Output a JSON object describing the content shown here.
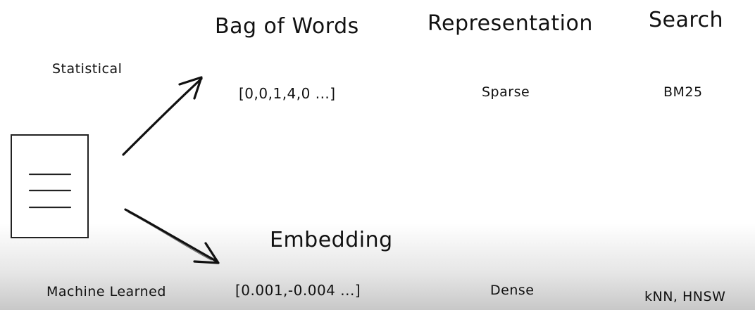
{
  "headers": {
    "bag_of_words": "Bag of Words",
    "representation": "Representation",
    "search": "Search",
    "embedding": "Embedding"
  },
  "approaches": {
    "statistical": "Statistical",
    "machine_learned": "Machine Learned"
  },
  "rows": {
    "sparse": {
      "vector": "[0,0,1,4,0 ...]",
      "representation": "Sparse",
      "search": "BM25"
    },
    "dense": {
      "vector": "[0.001,-0.004 ...]",
      "representation": "Dense",
      "search": "kNN, HNSW"
    }
  },
  "colors": {
    "ink": "#111111",
    "background": "#ffffff"
  },
  "icons": {
    "document": "document-icon",
    "arrow_up": "arrow-up-right-icon",
    "arrow_down": "arrow-down-right-icon"
  }
}
